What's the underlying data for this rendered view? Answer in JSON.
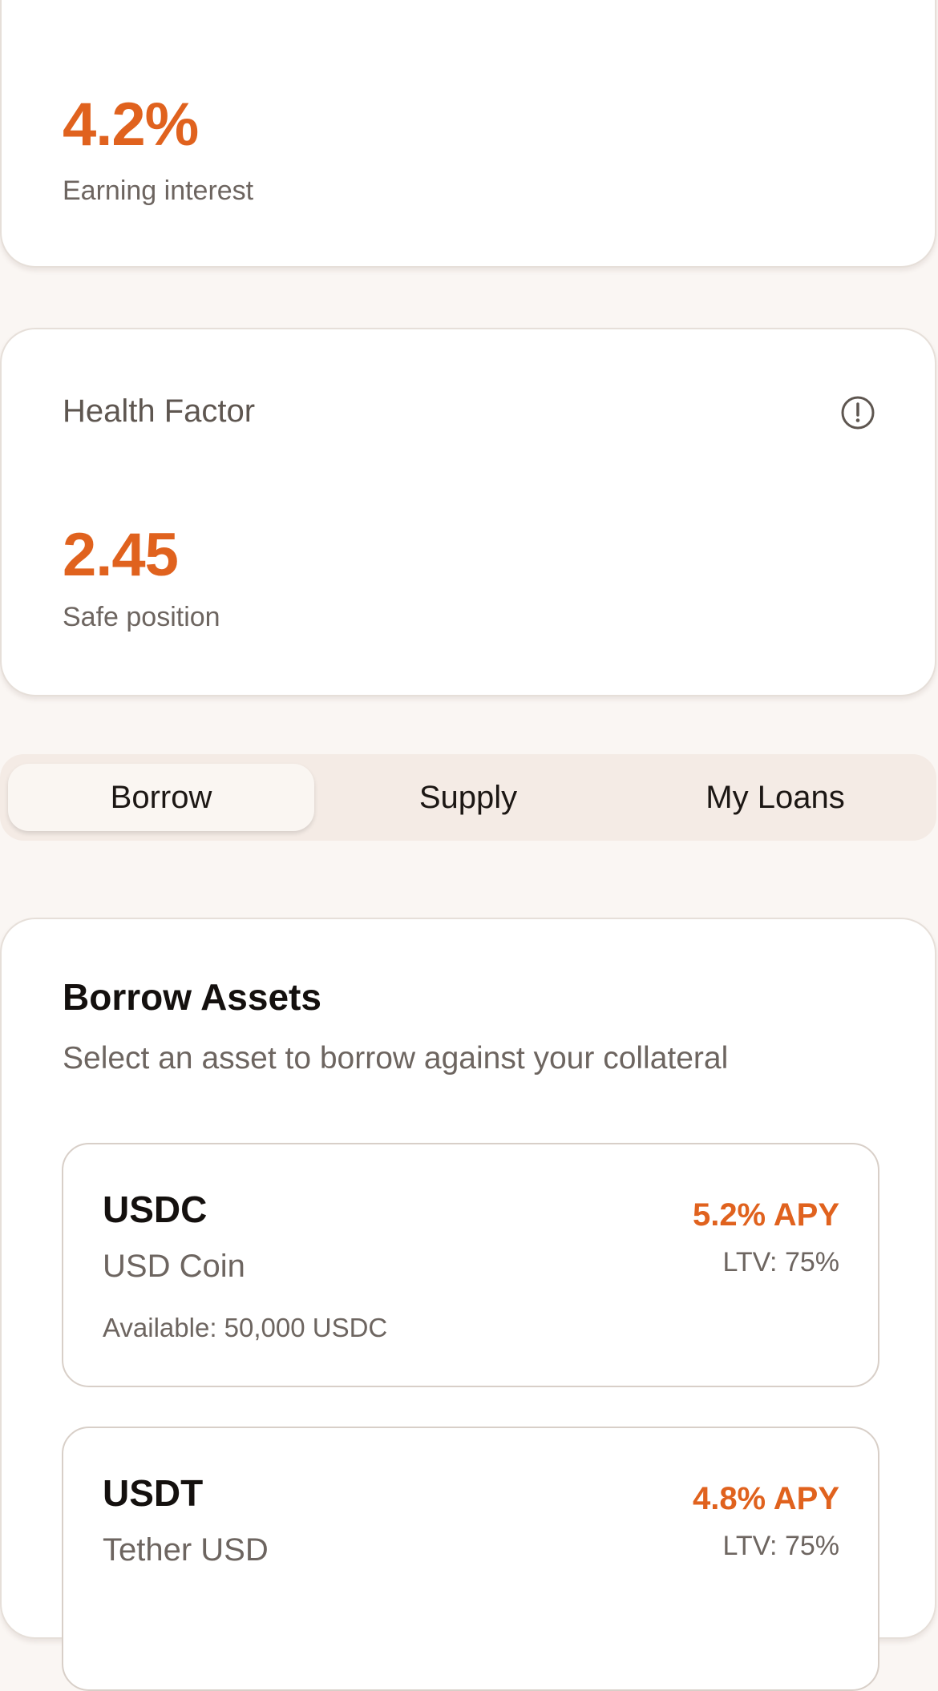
{
  "interest_card": {
    "value": "4.2%",
    "label": "Earning interest"
  },
  "health_card": {
    "title": "Health Factor",
    "info_icon": "info-icon",
    "value": "2.45",
    "label": "Safe position"
  },
  "tabs": [
    {
      "label": "Borrow",
      "active": true
    },
    {
      "label": "Supply",
      "active": false
    },
    {
      "label": "My Loans",
      "active": false
    }
  ],
  "borrow_section": {
    "title": "Borrow Assets",
    "description": "Select an asset to borrow against your collateral",
    "assets": [
      {
        "symbol": "USDC",
        "name": "USD Coin",
        "apy": "5.2% APY",
        "ltv": "LTV: 75%",
        "available": "Available: 50,000 USDC"
      },
      {
        "symbol": "USDT",
        "name": "Tether USD",
        "apy": "4.8% APY",
        "ltv": "LTV: 75%"
      }
    ]
  },
  "colors": {
    "accent": "#e0621e",
    "background": "#faf6f3",
    "tab_bar": "#f4ebe5"
  }
}
